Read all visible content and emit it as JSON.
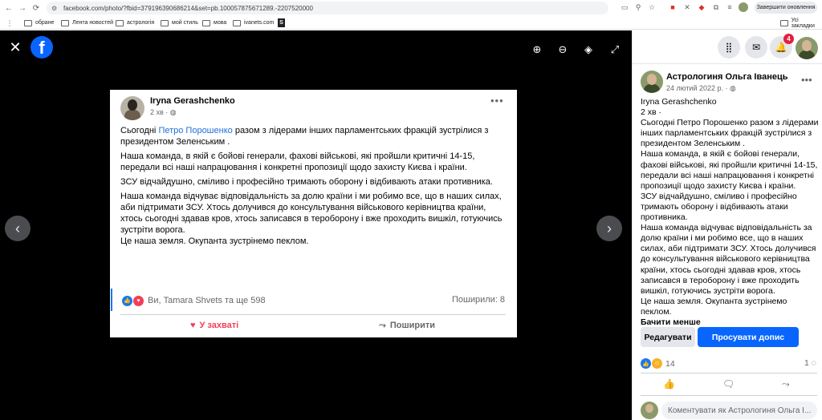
{
  "browser": {
    "url": "facebook.com/photo/?fbid=379196390686214&set=pb.100057875671289.-2207520000",
    "update_button": "Завершити оновлення",
    "bookmarks": [
      "обране",
      "Лента новостей",
      "астрологія",
      "мой стиль",
      "мова",
      "ivanets.com"
    ],
    "all_bookmarks": "Усі закладки"
  },
  "photo": {
    "author": "Iryna Gerashchenko",
    "time": "2 хв · ",
    "p1_before": "Сьогодні ",
    "p1_link": "Петро Порошенко",
    "p1_after": " разом з лідерами інших парламентських фракцій зустрілися з президентом Зеленським .",
    "p2": "Наша команда, в якій є бойові генерали, фахові військові, які пройшли критичні 14-15, передали всі наші напрацювання і конкретні пропозиції щодо захисту Києва і країни.",
    "p3": "ЗСУ відчайдушно, сміливо і професійно  тримають оборону і відбивають атаки противника.",
    "p4": "Наша команда відчуває відповідальність за долю країни і ми робимо все, що в наших силах, аби підтримати ЗСУ. Хтось долучився до консультування військового керівництва країни, хтось сьогодні здавав кров, хтось записався в тероборону і вже проходить вишкіл, готуючись зустріти ворога.",
    "p5": "Це наша земля. Окупанта зустрінемо пеклом.",
    "reactions": "Ви, Tamara Shvets та ще 598",
    "shares": "Поширили: 8",
    "action_like": "У захваті",
    "action_share": "Поширити"
  },
  "post": {
    "page_name": "Астрологиня Ольга Іванець",
    "date": "24 лютий 2022 р. · ",
    "lines": [
      "Iryna Gerashchenko",
      "2 хв ·",
      "Сьогодні Петро Порошенко разом з лідерами інших парламентських фракцій зустрілися з президентом Зеленським .",
      "Наша команда, в якій є бойові генерали, фахові військові, які пройшли критичні 14-15, передали всі наші напрацювання і конкретні пропозиції щодо захисту Києва і країни.",
      "ЗСУ відчайдушно, сміливо і професійно тримають оборону і відбивають атаки противника.",
      "Наша команда відчуває відповідальність за долю країни і ми робимо все, що в наших силах, аби підтримати ЗСУ. Хтось долучився до консультування військового керівництва країни, хтось сьогодні здавав кров, хтось записався в тероборону і вже проходить вишкіл, готуючись зустріти ворога.",
      "Це наша земля. Окупанта зустрінемо пеклом."
    ],
    "see_less": "Бачити менше",
    "edit_button": "Редагувати",
    "boost_button": "Просувати допис",
    "reaction_count": "14",
    "comment_count": "1",
    "comment_placeholder": "Коментувати як Астрологиня Ольга І..."
  },
  "notifications_badge": "4"
}
